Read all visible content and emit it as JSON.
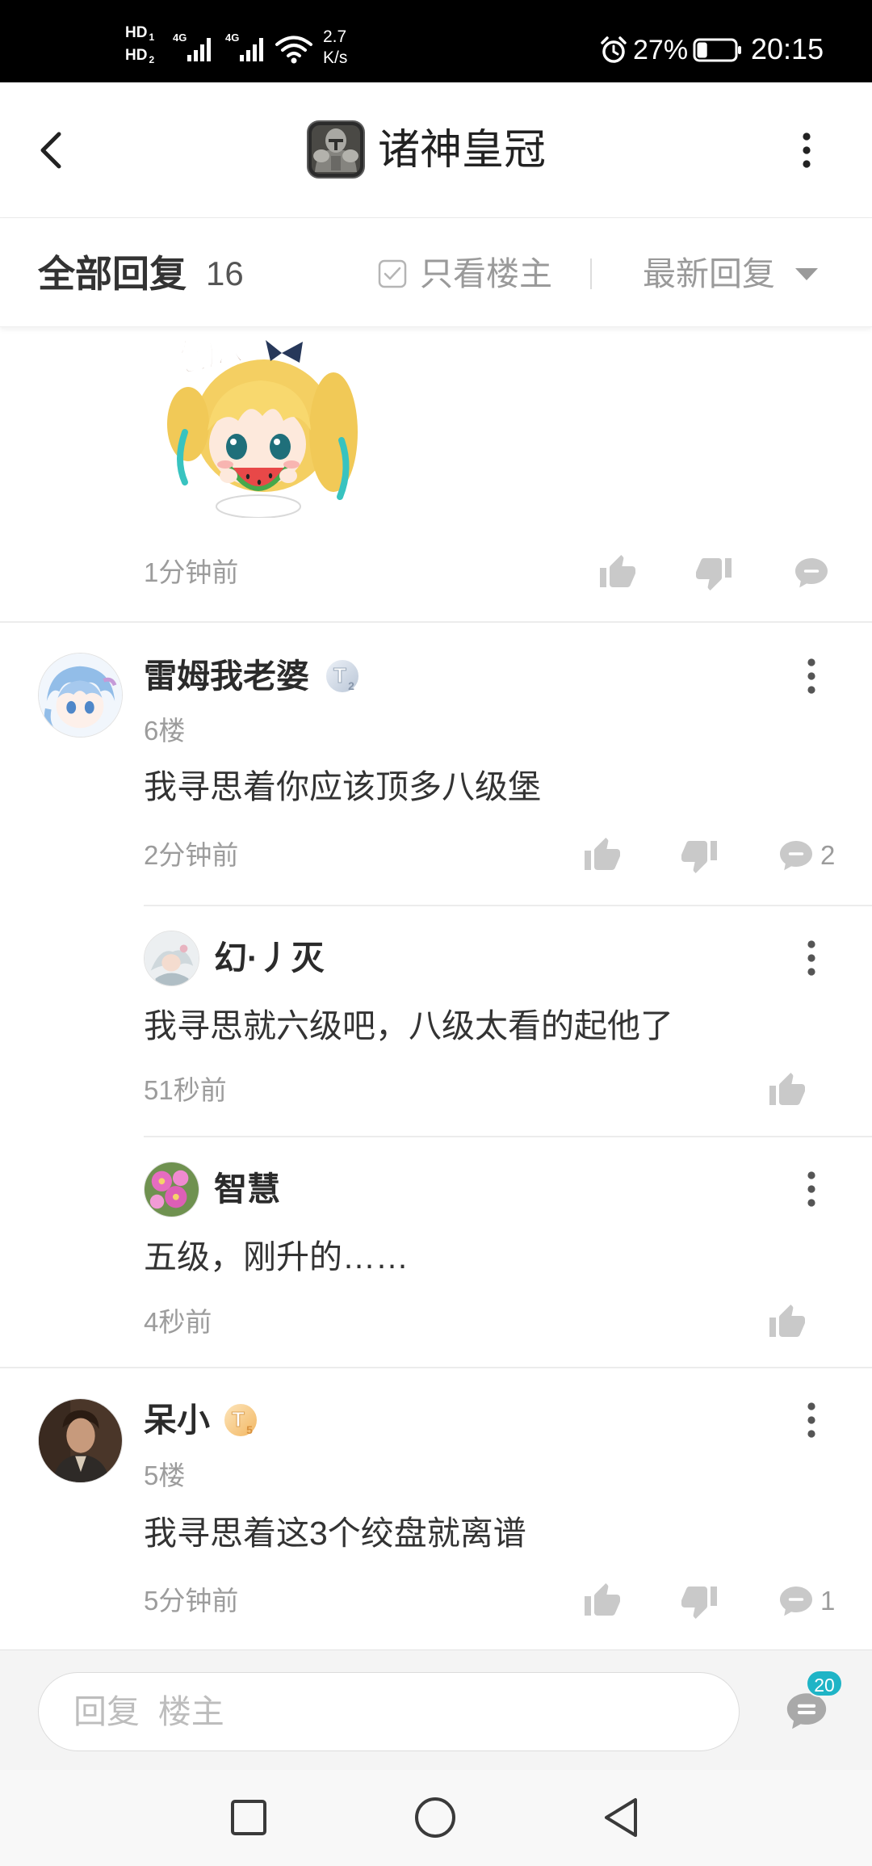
{
  "status_bar": {
    "sim1_label": "HD",
    "sim1_index": "1",
    "sim2_label": "HD",
    "sim2_index": "2",
    "sim1_network": "4G",
    "sim2_network": "4G",
    "net_speed": "2.7",
    "net_speed_unit": "K/s",
    "battery_percent": "27%",
    "clock": "20:15",
    "icons": [
      "signal-icon",
      "wifi-icon",
      "alarm-icon",
      "battery-icon"
    ]
  },
  "header": {
    "title": "诸神皇冠",
    "icons": {
      "back": "chevron-left-icon",
      "app": "game-app-icon",
      "menu": "more-vertical-icon"
    }
  },
  "sort_bar": {
    "title": "全部回复",
    "count": "16",
    "filter_label": "只看楼主",
    "sort_label": "最新回复",
    "icons": {
      "filter": "checkbox-icon",
      "sort": "caret-down-icon"
    }
  },
  "thread": {
    "top_post": {
      "sticker_caption": "吃瓜",
      "time": "1分钟前",
      "actions": [
        "thumbs-up-icon",
        "thumbs-down-icon",
        "comment-icon"
      ]
    },
    "comments": [
      {
        "user": "雷姆我老婆",
        "badge": {
          "letter": "T",
          "level": "2"
        },
        "floor": "6楼",
        "content": "我寻思着你应该顶多八级堡",
        "time": "2分钟前",
        "reply_count": "2",
        "replies": [
          {
            "user": "幻·丿灭",
            "content": "我寻思就六级吧，八级太看的起他了",
            "time": "51秒前"
          },
          {
            "user": "智慧",
            "content": "五级，刚升的……",
            "time": "4秒前"
          }
        ]
      },
      {
        "user": "呆小",
        "badge": {
          "letter": "T",
          "level": "5"
        },
        "floor": "5楼",
        "content": "我寻思着这3个绞盘就离谱",
        "time": "5分钟前",
        "reply_count": "1"
      }
    ]
  },
  "reply_bar": {
    "placeholder": "回复  楼主",
    "unread_count": "20",
    "icon": "comment-list-icon"
  },
  "nav_bar": {
    "icons": [
      "recents-square-icon",
      "home-circle-icon",
      "back-triangle-icon"
    ]
  },
  "colors": {
    "accent": "#1fb4c6",
    "text_primary": "#333333",
    "text_secondary": "#999999",
    "icon_muted": "#c9c9c9",
    "badge_t2": "#b8c5d6",
    "badge_t5": "#f2b660"
  }
}
